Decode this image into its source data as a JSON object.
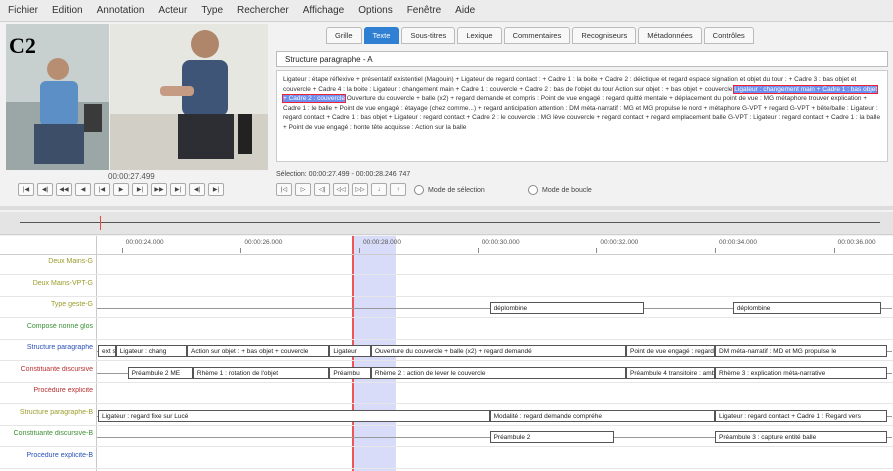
{
  "menu": [
    "Fichier",
    "Edition",
    "Annotation",
    "Acteur",
    "Type",
    "Rechercher",
    "Affichage",
    "Options",
    "Fenêtre",
    "Aide"
  ],
  "video": {
    "overlay_label": "C2",
    "timecode": "00:00:27.499"
  },
  "player_controls": [
    "|◀",
    "◀|",
    "◀◀",
    "◀",
    "|◀",
    "▶",
    "▶|",
    "▶▶",
    "▶|",
    "◀|",
    "▶|"
  ],
  "tabs": [
    "Grille",
    "Texte",
    "Sous-titres",
    "Lexique",
    "Commentaires",
    "Recogniseurs",
    "Métadonnées",
    "Contrôles"
  ],
  "active_tab_index": 1,
  "text_panel": {
    "tier_title": "Structure paragraphe - A",
    "text_before": "Ligateur : étape réflexive + présentatif existentiel (Magouin) + Ligateur de regard contact : + Cadre 1 : la boite + Cadre 2 : déictique et regard espace signation et objet du tour : + Cadre 3 : bas objet et couvercle + Cadre 4 : la boite : Ligateur : changement main + Cadre 1 : couvercle + Cadre 2 : bas de l'objet du tour Action sur objet : + bas objet + couvercle",
    "text_highlight": "Ligateur : changement main + Cadre 1 : bas objet + Cadre 2 : couvercle",
    "text_after": " Ouverture du couvercle + balle (x2) + regard demande et compris : Point de vue engagé : regard quitté mentale + déplacement du point de vue : MG métaphore trouver explication + Cadre 1 : le balle + Point de vue engagé : étayage (chez comme...) + regard anticipation attention : DM méta-narratif : MG et MG propulse le nord + métaphore G-VPT + regard G-VPT + bête/balle : Ligateur : regard contact + Cadre 1 : bas objet + Ligateur : regard contact + Cadre 2 : le couvercle : MG lève couvercle + regard contact + regard emplacement balle G-VPT : Ligateur : regard contact + Cadre 1 : la balle + Point de vue engagé : honte tête acquisse : Action sur la balle"
  },
  "selection": {
    "text": "Sélection: 00:00:27.499 - 00:00:28.246  747"
  },
  "selection_controls": [
    "|◁",
    "▷",
    "◁|",
    "◁◁",
    "▷▷",
    "↓",
    "↑"
  ],
  "modes": {
    "selection": "Mode de sélection",
    "loop": "Mode de boucle"
  },
  "timeline": {
    "ticks": [
      "00:00:24.000",
      "00:00:26.000",
      "00:00:28.000",
      "00:00:30.000",
      "00:00:32.000",
      "00:00:34.000",
      "00:00:36.000"
    ],
    "tiers": [
      {
        "name": "Deux Mains-G",
        "color": "olive",
        "annotations": []
      },
      {
        "name": "Deux Mains-VPT-G",
        "color": "olive",
        "annotations": []
      },
      {
        "name": "Type geste-G",
        "color": "olive",
        "annotations": [
          {
            "text": "déplombine",
            "start": 30.2,
            "end": 32.8
          },
          {
            "text": "déplombine",
            "start": 34.3,
            "end": 36.8
          }
        ]
      },
      {
        "name": "Composé nonné glos",
        "color": "green",
        "annotations": []
      },
      {
        "name": "Structure paragraphe",
        "color": "blue",
        "annotations": [
          {
            "text": "ext sur",
            "start": 23.6,
            "end": 23.9
          },
          {
            "text": "Ligateur : chang",
            "start": 23.9,
            "end": 25.1
          },
          {
            "text": "Action sur objet : + bas objet + couvercle",
            "start": 25.1,
            "end": 27.5
          },
          {
            "text": "Ligateur",
            "start": 27.5,
            "end": 28.2
          },
          {
            "text": "Ouverture du couvercle + balle (x2) + regard demandé",
            "start": 28.2,
            "end": 32.5
          },
          {
            "text": "Point de vue engagé : regard",
            "start": 32.5,
            "end": 34.0
          },
          {
            "text": "DM méta-narratif : MD et MG propulse le",
            "start": 34.0,
            "end": 36.9
          }
        ]
      },
      {
        "name": "Constituante discursive",
        "color": "red",
        "annotations": [
          {
            "text": "Préambule 2 ME",
            "start": 24.1,
            "end": 25.2
          },
          {
            "text": "Rhème 1 : rotation de l'objet",
            "start": 25.2,
            "end": 27.5
          },
          {
            "text": "Préambu",
            "start": 27.5,
            "end": 28.2
          },
          {
            "text": "Rhème 2 : action de lever le couvercle",
            "start": 28.2,
            "end": 32.5
          },
          {
            "text": "Préambule 4 transitoire : amb",
            "start": 32.5,
            "end": 34.0
          },
          {
            "text": "Rhème 3 : explication méta-narrative",
            "start": 34.0,
            "end": 36.9
          }
        ]
      },
      {
        "name": "Procédure explicite",
        "color": "red",
        "annotations": []
      },
      {
        "name": "Structure paragraphe-B",
        "color": "olive",
        "annotations": [
          {
            "text": "Ligateur : regard fixe sur Lucé",
            "start": 23.6,
            "end": 30.2
          },
          {
            "text": "Modalité : regard demande compréhe",
            "start": 30.2,
            "end": 34.0
          },
          {
            "text": "Ligateur : regard contact + Cadre 1 : Regard vers",
            "start": 34.0,
            "end": 36.9
          }
        ]
      },
      {
        "name": "Constituante discursive-B",
        "color": "green",
        "annotations": [
          {
            "text": "Préambule 2",
            "start": 30.2,
            "end": 32.3
          },
          {
            "text": "Préambule 3 : capture entité balle",
            "start": 34.0,
            "end": 36.9
          }
        ]
      },
      {
        "name": "Procédure explicite-B",
        "color": "blue",
        "annotations": []
      }
    ]
  },
  "colors": {
    "accent": "#2f7fd3",
    "cursor": "#e55555",
    "selection": "#7882e6"
  }
}
